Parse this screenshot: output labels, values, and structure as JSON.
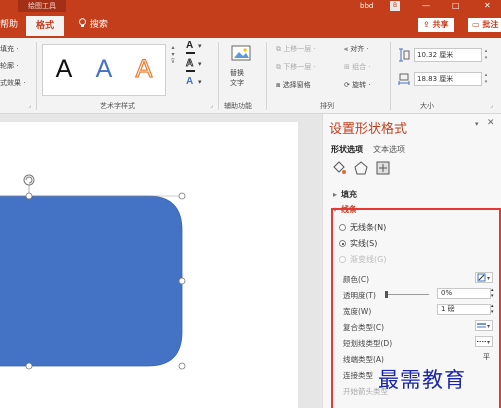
{
  "titlebar": {
    "tool_tab": "绘图工具",
    "user": "bbd",
    "badge": "B",
    "controls": [
      "—",
      "□",
      "✕"
    ]
  },
  "tabs": {
    "help": "帮助",
    "format": "格式",
    "search": "搜索",
    "share": "共享",
    "comment": "批注"
  },
  "ribbon": {
    "shape_styles": {
      "fill": "填充 ·",
      "outline": "轮廓 ·",
      "effects": "式效果 ·"
    },
    "wordart": {
      "samples": [
        "A",
        "A",
        "A"
      ],
      "label": "艺术字样式",
      "text_fill": "A",
      "text_outline": "A",
      "text_effects": "A"
    },
    "accessibility": {
      "alt_text_line1": "替换",
      "alt_text_line2": "文字",
      "label": "辅助功能"
    },
    "arrange": {
      "bring_forward": "上移一层 ·",
      "send_backward": "下移一层 ·",
      "selection_pane": "选择窗格",
      "align": "对齐 ·",
      "group": "组合 ·",
      "rotate": "旋转 ·",
      "label": "排列"
    },
    "size": {
      "height": "10.32 厘米",
      "width": "18.83 厘米",
      "label": "大小"
    }
  },
  "pane": {
    "title": "设置形状格式",
    "tab_shape_options": "形状选项",
    "tab_text_options": "文本选项",
    "fill_section": "填充",
    "line_section": "线条",
    "radios": {
      "no_line": "无线条(N)",
      "solid_line": "实线(S)",
      "gradient_line": "渐变线(G)"
    },
    "props": {
      "color": "颜色(C)",
      "transparency": "透明度(T)",
      "transparency_value": "0%",
      "width": "宽度(W)",
      "width_value": "1 磅",
      "compound_type": "复合类型(C)",
      "dash_type": "短划线类型(D)",
      "cap_type": "线端类型(A)",
      "cap_type_value": "平",
      "join_type": "连接类型",
      "begin_arrow": "开始箭头类型"
    }
  },
  "watermark": "最需教育",
  "colors": {
    "accent": "#c43e1c",
    "shape_fill": "#4472c4",
    "highlight_border": "#e53935",
    "watermark": "#1b27a8"
  }
}
